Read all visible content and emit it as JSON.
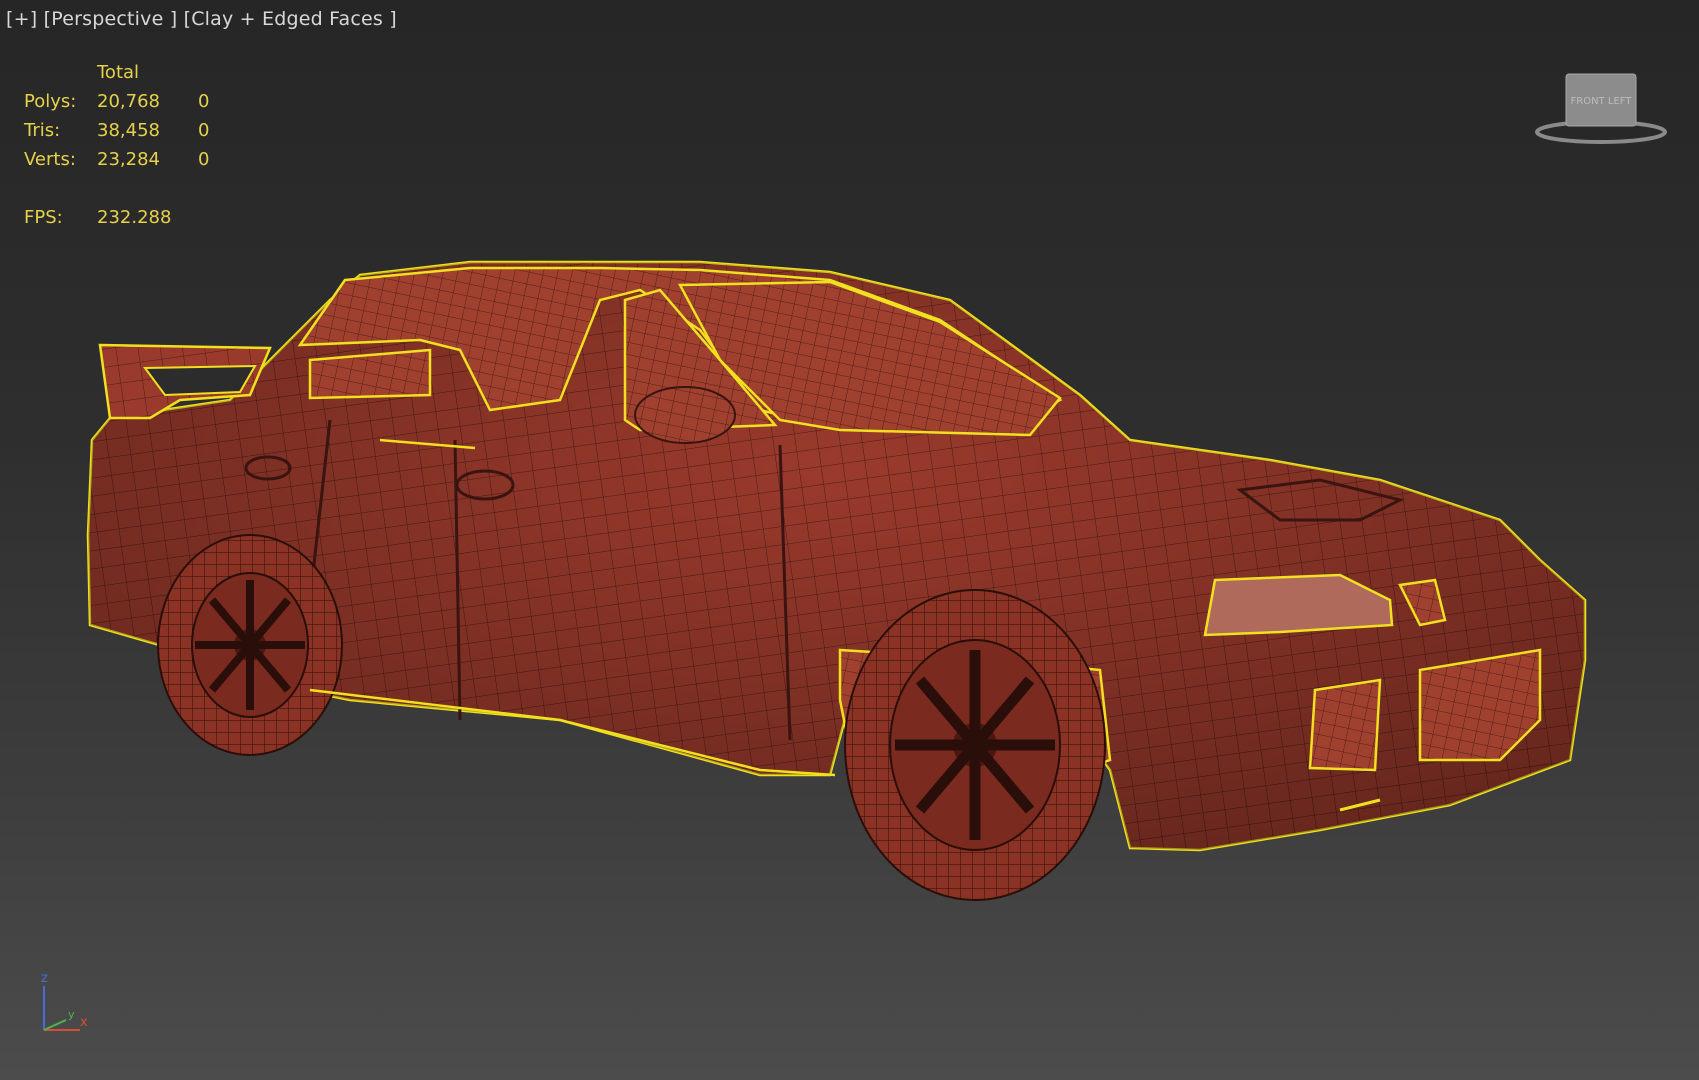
{
  "viewport": {
    "label_plus": "[+]",
    "label_view": "[Perspective ]",
    "label_shading": "[Clay + Edged Faces ]"
  },
  "stats": {
    "header": "Total",
    "rows": [
      {
        "label": "Polys:",
        "total": "20,768",
        "selected": "0"
      },
      {
        "label": "Tris:",
        "total": "38,458",
        "selected": "0"
      },
      {
        "label": "Verts:",
        "total": "23,284",
        "selected": "0"
      }
    ],
    "fps_label": "FPS:",
    "fps_value": "232.288"
  },
  "viewcube": {
    "face_text": "FRONT  LEFT"
  },
  "axis": {
    "z": "z",
    "x": "x",
    "y": "y"
  },
  "colors": {
    "stats_text": "#e6d24a",
    "model_clay": "#9a3a2c",
    "selection_outline": "#f0e020",
    "edge_lines": "#3a1410",
    "axis_z": "#4a6ad8",
    "axis_x": "#d84a3a",
    "axis_y": "#4ab84a"
  }
}
